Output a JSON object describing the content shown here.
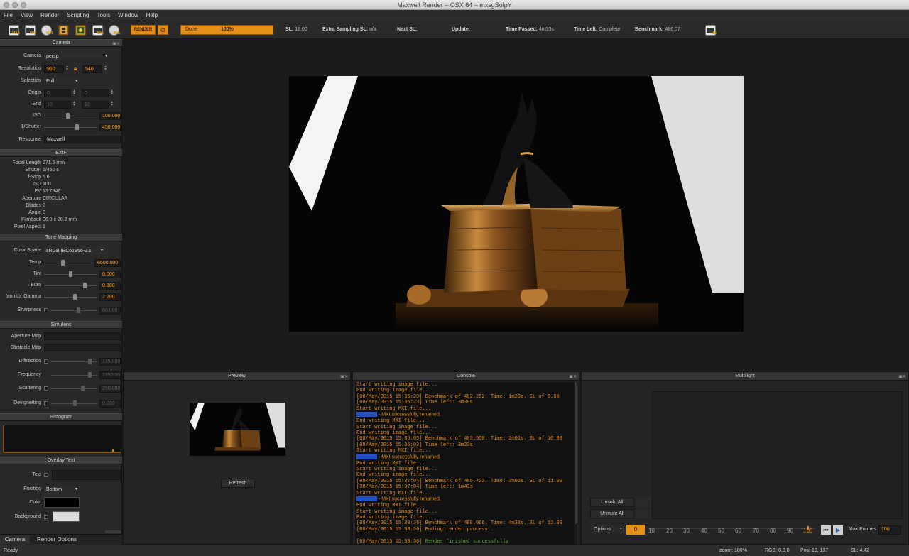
{
  "window": {
    "title": "Maxwell Render  –  OSX 64 – mxsgSolpY"
  },
  "menu": [
    "File",
    "View",
    "Render",
    "Scripting",
    "Tools",
    "Window",
    "Help"
  ],
  "toolbar": {
    "icons": [
      {
        "name": "open-mxs-icon",
        "tag": "MXS"
      },
      {
        "name": "open-mxi-icon",
        "tag": "MXI"
      },
      {
        "name": "save-mxi-icon",
        "tag": "MXI"
      },
      {
        "name": "film-icon",
        "tag": ""
      },
      {
        "name": "image-icon",
        "tag": ""
      },
      {
        "name": "save-image-icon",
        "tag": "IMG"
      },
      {
        "name": "open-image-icon",
        "tag": "IMG"
      }
    ],
    "render_label": "RENDER",
    "render_alt_glyph": "⧉",
    "progress_label": "Done",
    "progress_value": "100%",
    "progress_fraction": 1.0,
    "sl_label": "SL:",
    "sl_value": "12.00",
    "extra_label": "Extra Sampling SL:",
    "extra_value": "n/a",
    "next_label": "Next SL:",
    "update_label": "Update:",
    "time_passed_label": "Time Passed:",
    "time_passed_value": "4m33s",
    "time_left_label": "Time Left:",
    "time_left_value": "Complete",
    "benchmark_label": "Benchmark:",
    "benchmark_value": "486.07",
    "ms_tag": "MS"
  },
  "camera": {
    "header": "Camera",
    "camera_label": "Camera",
    "camera_value": "persp",
    "resolution_label": "Resolution",
    "res_w": "960",
    "res_h": "540",
    "selection_label": "Selection",
    "selection_value": "Full",
    "origin_label": "Origin",
    "origin_x": "0",
    "origin_y": "0",
    "end_label": "End",
    "end_x": "10",
    "end_y": "10",
    "iso_label": "ISO",
    "iso_value": "100.000",
    "shutter_label": "1/Shutter",
    "shutter_value": "450.000",
    "response_label": "Response",
    "response_value": "Maxwell"
  },
  "exif": {
    "header": "EXIF",
    "rows": [
      {
        "k": "Focal Length",
        "v": "271.5 mm"
      },
      {
        "k": "Shutter",
        "v": "1/450 s"
      },
      {
        "k": "f-Stop",
        "v": "5.6"
      },
      {
        "k": "ISO",
        "v": "100"
      },
      {
        "k": "EV",
        "v": "13.7846"
      },
      {
        "k": "Aperture",
        "v": "CIRCULAR"
      },
      {
        "k": "Blades",
        "v": "0"
      },
      {
        "k": "Angle",
        "v": "0"
      },
      {
        "k": "Filmback",
        "v": "36.0 x 20.2 mm"
      },
      {
        "k": "Pixel Aspect",
        "v": "1"
      }
    ]
  },
  "tone": {
    "header": "Tone Mapping",
    "colorspace_label": "Color Space",
    "colorspace_value": "sRGB IEC61966-2.1",
    "temp_label": "Temp",
    "temp_value": "6500.000",
    "tint_label": "Tint",
    "tint_value": "0.000",
    "burn_label": "Burn",
    "burn_value": "0.800",
    "gamma_label": "Monitor Gamma",
    "gamma_value": "2.200",
    "sharp_label": "Sharpness",
    "sharp_value": "60.000"
  },
  "simulens": {
    "header": "Simulens",
    "aperture_label": "Aperture Map",
    "obstacle_label": "Obstacle Map",
    "diffraction_label": "Diffraction",
    "diffraction_value": "1350.000",
    "frequency_label": "Frequency",
    "frequency_value": "1350.000",
    "scattering_label": "Scattering",
    "scattering_value": "250.000",
    "devignetting_label": "Devignetting",
    "devignetting_value": "0.000"
  },
  "histogram": {
    "header": "Histogram"
  },
  "overlay": {
    "header": "Overlay Text",
    "text_label": "Text",
    "position_label": "Position",
    "position_value": "Bottom",
    "color_label": "Color",
    "background_label": "Background"
  },
  "tabs": {
    "camera": "Camera",
    "render_options": "Render Options"
  },
  "preview": {
    "header": "Preview",
    "refresh": "Refresh"
  },
  "console": {
    "header": "Console",
    "lines": [
      {
        "t": "Start writing image file...",
        "k": "l"
      },
      {
        "t": "End writing image file...",
        "k": "l"
      },
      {
        "t": "[08/May/2015 15:35:23] Benchmark of 482.252. Time: 1m20s. SL of 9.00",
        "k": "l"
      },
      {
        "t": "[08/May/2015 15:35:23] Time left: 3m39s",
        "k": "l"
      },
      {
        "t": "Start writing MXI file...",
        "k": "l"
      },
      {
        "t": " - MXI successfully renamed.",
        "k": "n"
      },
      {
        "t": "End writing MXI file...",
        "k": "l"
      },
      {
        "t": "Start writing image file...",
        "k": "l"
      },
      {
        "t": "End writing image file...",
        "k": "l"
      },
      {
        "t": "[08/May/2015 15:36:03] Benchmark of 483.550. Time: 2m01s. SL of 10.00",
        "k": "l"
      },
      {
        "t": "[08/May/2015 15:36:03] Time left: 3m23s",
        "k": "l"
      },
      {
        "t": "Start writing MXI file...",
        "k": "l"
      },
      {
        "t": " - MXI successfully renamed.",
        "k": "n"
      },
      {
        "t": "End writing MXI file...",
        "k": "l"
      },
      {
        "t": "Start writing image file...",
        "k": "l"
      },
      {
        "t": "End writing image file...",
        "k": "l"
      },
      {
        "t": "[08/May/2015 15:37:04] Benchmark of 485.723. Time: 3m02s. SL of 11.00",
        "k": "l"
      },
      {
        "t": "[08/May/2015 15:37:04] Time left: 1m43s",
        "k": "l"
      },
      {
        "t": "Start writing MXI file...",
        "k": "l"
      },
      {
        "t": " - MXI successfully renamed.",
        "k": "n"
      },
      {
        "t": "End writing MXI file...",
        "k": "l"
      },
      {
        "t": "Start writing image file...",
        "k": "l"
      },
      {
        "t": "End writing image file...",
        "k": "l"
      },
      {
        "t": "[08/May/2015 15:38:36] Benchmark of 488.066. Time: 4m33s. SL of 12.00",
        "k": "l"
      },
      {
        "t": "[08/May/2015 15:38:36] Ending render process..",
        "k": "l"
      },
      {
        "t": "",
        "k": "l"
      },
      {
        "t": "[08/May/2015 15:38:36] ",
        "k": "l",
        "g": "Render finished successfully"
      }
    ]
  },
  "multilight": {
    "header": "Multilight",
    "unsolo": "Unsolo All",
    "unmute": "Unmute All",
    "options": "Options",
    "frame_current": "0",
    "frames": [
      "10",
      "20",
      "30",
      "40",
      "50",
      "60",
      "70",
      "80",
      "90",
      "100"
    ],
    "maxframes_label": "Max.Frames",
    "maxframes_value": "100"
  },
  "status": {
    "left": "Ready",
    "zoom": "zoom: 100%",
    "rgb": "RGB: 0,0,0",
    "pos": "Pos: 10, 137",
    "sl": "SL: 4.42"
  },
  "colors": {
    "accent": "#e58f1b",
    "console_text": "#e28b1f",
    "success": "#59a63b",
    "highlight": "#2350c8"
  }
}
